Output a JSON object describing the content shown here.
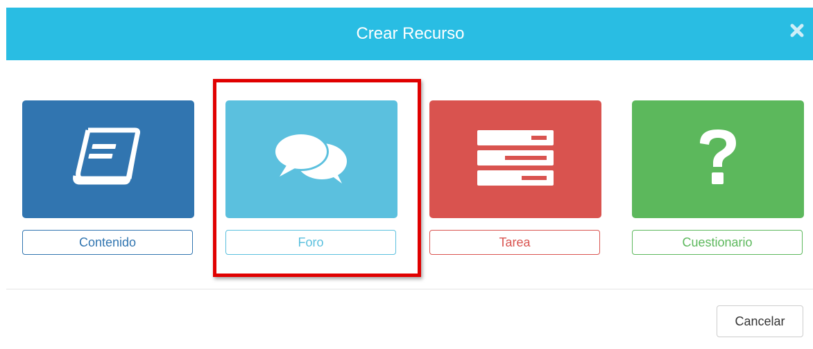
{
  "modal": {
    "title": "Crear Recurso"
  },
  "resources": [
    {
      "key": "contenido",
      "label": "Contenido",
      "icon": "book-icon",
      "color": "#3175b0"
    },
    {
      "key": "foro",
      "label": "Foro",
      "icon": "chat-bubbles-icon",
      "color": "#5bc0de"
    },
    {
      "key": "tarea",
      "label": "Tarea",
      "icon": "task-list-icon",
      "color": "#d9534f"
    },
    {
      "key": "cuestionario",
      "label": "Cuestionario",
      "icon": "question-mark-icon",
      "color": "#5cb85c"
    }
  ],
  "highlighted": "foro",
  "highlight_color": "#e00000",
  "footer": {
    "cancel_label": "Cancelar"
  }
}
